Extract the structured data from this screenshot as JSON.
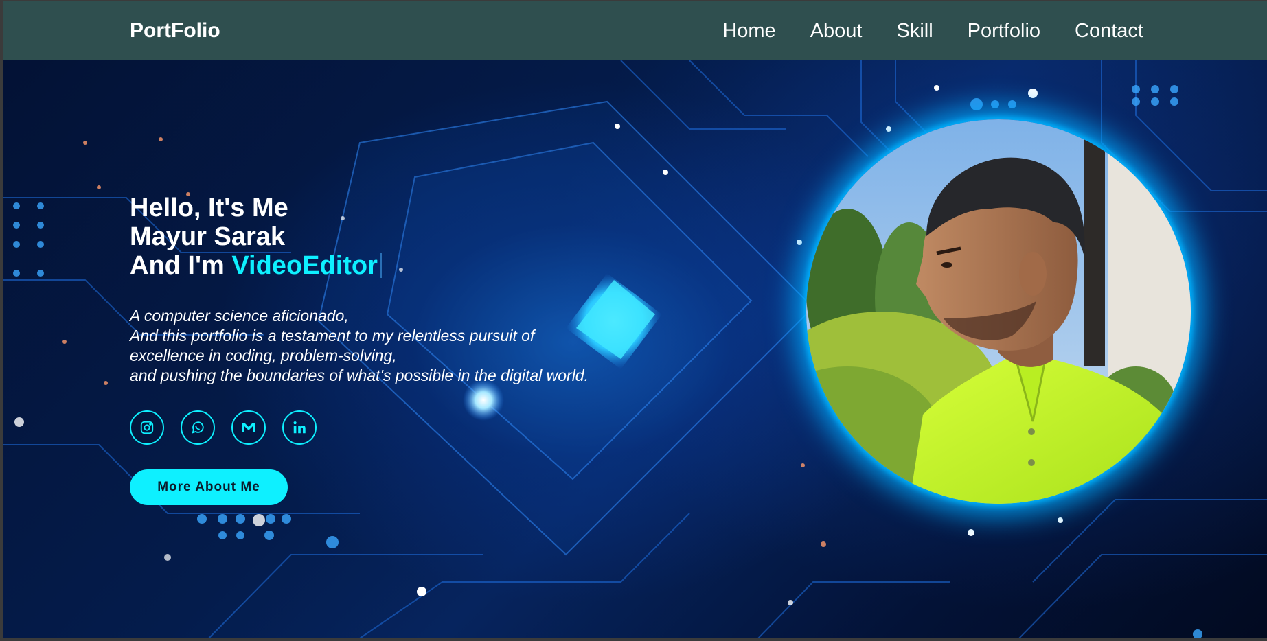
{
  "header": {
    "logo": "PortFolio",
    "nav": [
      {
        "label": "Home"
      },
      {
        "label": "About"
      },
      {
        "label": "Skill"
      },
      {
        "label": "Portfolio"
      },
      {
        "label": "Contact"
      }
    ]
  },
  "hero": {
    "greeting": "Hello, It's Me",
    "name": "Mayur Sarak",
    "role_prefix": "And I'm ",
    "role": "VideoEditor",
    "bio": [
      "A computer science aficionado,",
      "And this portfolio is a testament to my relentless pursuit of",
      "excellence in coding, problem-solving,",
      "and pushing the boundaries of what's possible in the digital world."
    ],
    "socials": [
      {
        "icon": "instagram-icon"
      },
      {
        "icon": "whatsapp-icon"
      },
      {
        "icon": "gmail-icon"
      },
      {
        "icon": "linkedin-icon"
      }
    ],
    "cta_label": "More About Me"
  },
  "colors": {
    "header_bg": "#2f4f4f",
    "accent": "#0ef0ff",
    "text": "#ffffff"
  }
}
